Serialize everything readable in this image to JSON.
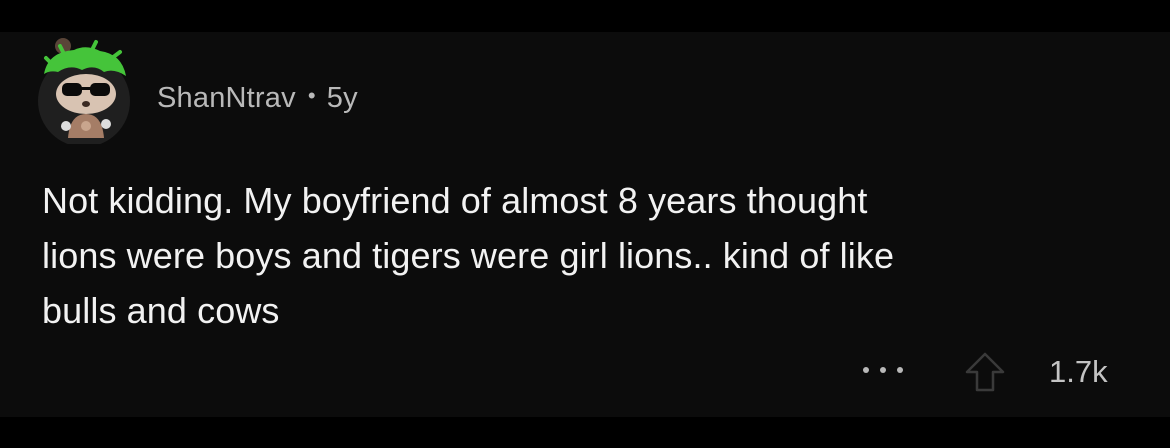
{
  "comment": {
    "author": "ShanNtrav",
    "separator": "•",
    "age": "5y",
    "body": "Not kidding. My boyfriend of almost 8 years thought\nlions were boys and tigers were girl lions.. kind of like\nbulls and cows",
    "score": "1.7k"
  },
  "icons": {
    "avatar": "avatar-snoo-green-hair-sunglasses",
    "more": "more-dots-icon",
    "upvote": "upvote-arrow-icon"
  },
  "colors": {
    "background": "#000000",
    "card": "#0c0c0c",
    "text": "#f2f2f2",
    "meta": "#b9b9b9",
    "avatar_hair": "#45c43a"
  }
}
